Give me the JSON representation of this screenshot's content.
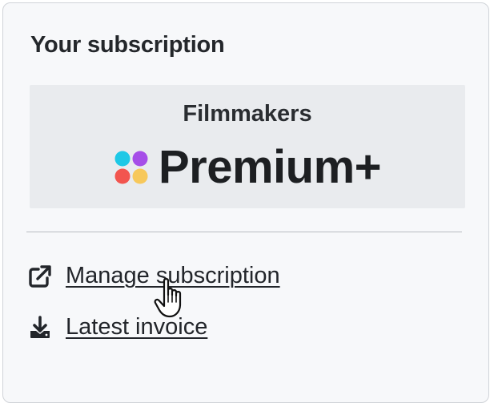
{
  "subscription_card": {
    "title": "Your subscription",
    "plan": {
      "tier": "Filmmakers",
      "name": "Premium+",
      "logo_icon": "four-dots-logo-icon",
      "logo_colors": [
        "#1ec8e6",
        "#a64ee8",
        "#f2554f",
        "#f7c85b"
      ]
    },
    "links": {
      "manage": {
        "label": "Manage subscription",
        "icon": "external-link-icon"
      },
      "invoice": {
        "label": "Latest invoice",
        "icon": "download-icon"
      }
    }
  },
  "pointer": {
    "icon": "hand-pointer-cursor-icon"
  }
}
